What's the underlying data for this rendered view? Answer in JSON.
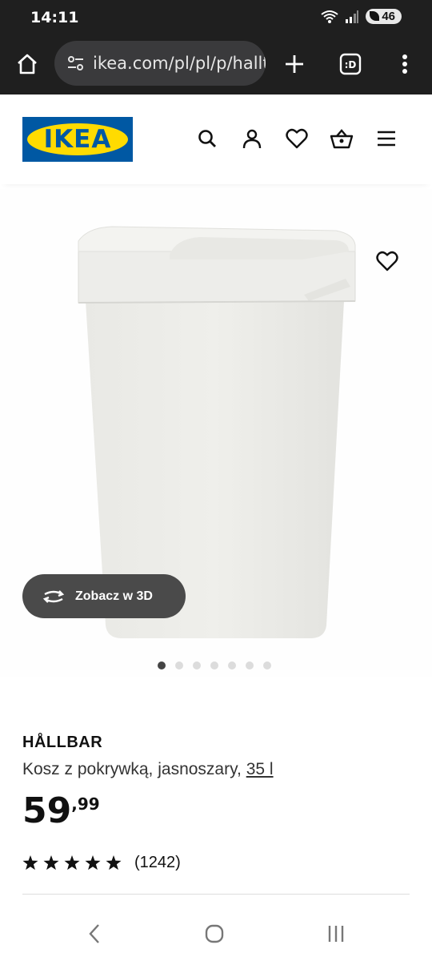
{
  "status_bar": {
    "time": "14:11",
    "battery": "46"
  },
  "browser": {
    "url": "ikea.com/pl/pl/p/hallt"
  },
  "header": {
    "logo_text": "IKEA",
    "brand_blue": "#0058a3",
    "brand_yellow": "#ffdb00"
  },
  "gallery": {
    "view_3d_label": "Zobacz w 3D",
    "image_count": 7,
    "active_index": 0
  },
  "product": {
    "name": "HÅLLBAR",
    "description": "Kosz z pokrywką, jasnoszary,",
    "size_link": "35 l",
    "price_integer": "59",
    "price_decimal": ",99",
    "rating_stars": 5,
    "review_count": "(1242)"
  }
}
